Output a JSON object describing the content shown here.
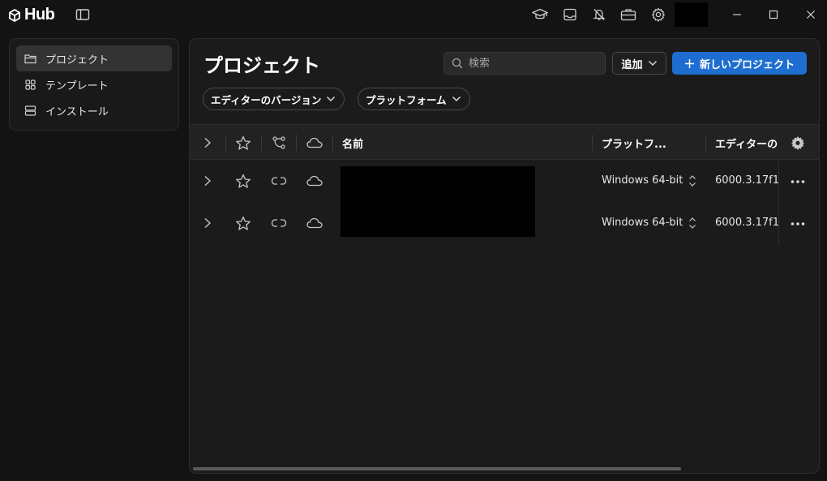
{
  "app": {
    "logo_text": "Hub"
  },
  "sidebar": {
    "items": [
      {
        "label": "プロジェクト",
        "icon": "folder-icon",
        "active": true
      },
      {
        "label": "テンプレート",
        "icon": "grid-icon",
        "active": false
      },
      {
        "label": "インストール",
        "icon": "server-icon",
        "active": false
      }
    ]
  },
  "main": {
    "title": "プロジェクト",
    "search": {
      "placeholder": "検索",
      "value": ""
    },
    "add_label": "追加",
    "new_project_label": "新しいプロジェクト",
    "filters": [
      {
        "label": "エディターのバージョン"
      },
      {
        "label": "プラットフォーム"
      }
    ],
    "table": {
      "columns": {
        "name": "名前",
        "platform": "プラットフ...",
        "editor": "エディターの"
      },
      "rows": [
        {
          "platform": "Windows 64-bit",
          "editor": "6000.3.17f1"
        },
        {
          "platform": "Windows 64-bit",
          "editor": "6000.3.17f1"
        }
      ]
    }
  },
  "colors": {
    "accent": "#1e6ed1",
    "background": "#131313",
    "panel": "#1b1b1b"
  }
}
